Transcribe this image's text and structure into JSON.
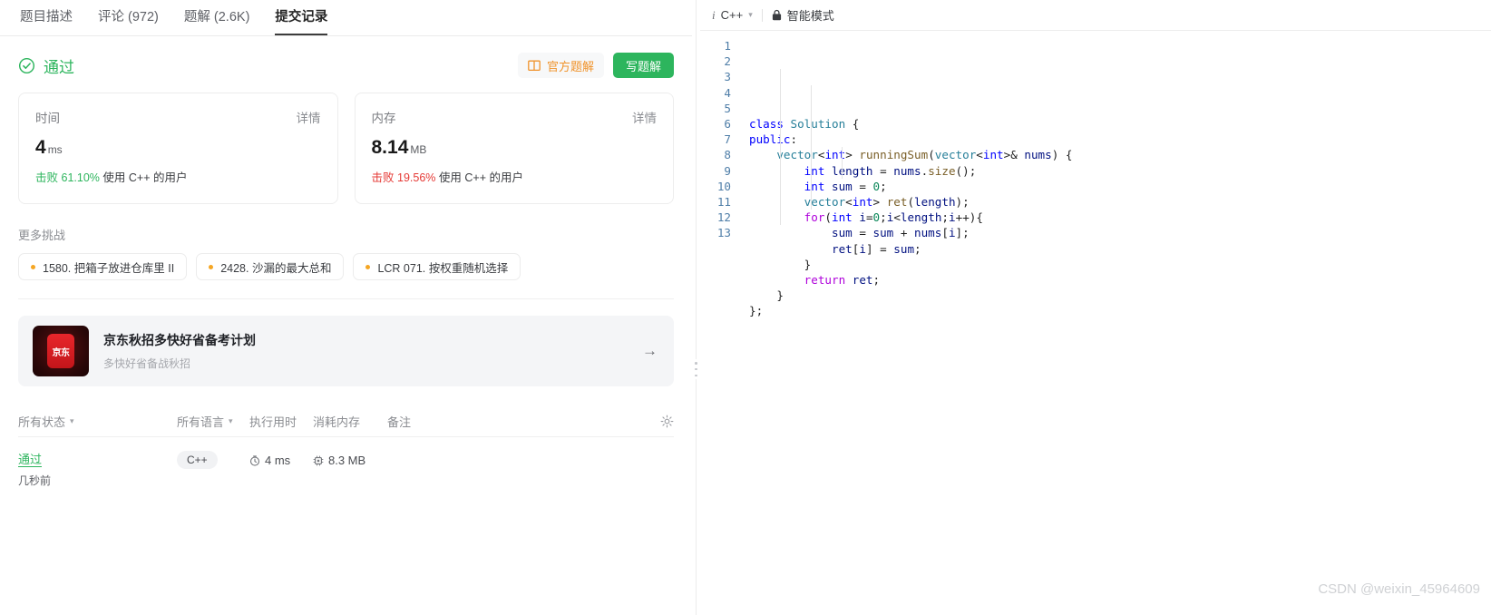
{
  "tabs": [
    {
      "label": "题目描述",
      "active": false
    },
    {
      "label": "评论 (972)",
      "active": false
    },
    {
      "label": "题解 (2.6K)",
      "active": false
    },
    {
      "label": "提交记录",
      "active": true
    }
  ],
  "status": {
    "text": "通过",
    "icon": "check-circle-icon",
    "color": "#2db55d"
  },
  "actions": {
    "official_solution": "官方题解",
    "official_icon": "book-icon",
    "write_solution": "写题解",
    "official_color": "#f0932b",
    "write_color": "#2db55d"
  },
  "stats": [
    {
      "label": "时间",
      "detail": "详情",
      "value": "4",
      "unit": "ms",
      "beat_prefix": "击败",
      "beat_percent": "61.10%",
      "beat_suffix": "使用 C++ 的用户",
      "beat_color": "#2db55d"
    },
    {
      "label": "内存",
      "detail": "详情",
      "value": "8.14",
      "unit": "MB",
      "beat_prefix": "击败",
      "beat_percent": "19.56%",
      "beat_suffix": "使用 C++ 的用户",
      "beat_color": "#e53935"
    }
  ],
  "more_challenges": {
    "title": "更多挑战",
    "items": [
      "1580. 把箱子放进仓库里 II",
      "2428. 沙漏的最大总和",
      "LCR 071. 按权重随机选择"
    ],
    "dot_color": "#f5a623"
  },
  "ad": {
    "logo_text": "京东",
    "title": "京东秋招多快好省备考计划",
    "subtitle": "多快好省备战秋招",
    "arrow": "→"
  },
  "table": {
    "headers": {
      "status": "所有状态",
      "language": "所有语言",
      "runtime": "执行用时",
      "memory": "消耗内存",
      "note": "备注",
      "settings_icon": "gear-icon"
    },
    "rows": [
      {
        "status": "通过",
        "time_ago": "几秒前",
        "language": "C++",
        "runtime": "4 ms",
        "memory": "8.3 MB",
        "runtime_icon": "stopwatch-icon",
        "memory_icon": "chip-icon",
        "note": ""
      }
    ]
  },
  "editor": {
    "info_glyph": "i",
    "language": "C++",
    "caret": "˅",
    "lock_icon": "lock-icon",
    "mode": "智能模式",
    "line_numbers": [
      "1",
      "2",
      "3",
      "4",
      "5",
      "6",
      "7",
      "8",
      "9",
      "10",
      "11",
      "12",
      "13"
    ],
    "code_lines": [
      [
        {
          "t": "kw",
          "s": "class"
        },
        {
          "t": "plain",
          "s": " "
        },
        {
          "t": "type",
          "s": "Solution"
        },
        {
          "t": "plain",
          "s": " {"
        }
      ],
      [
        {
          "t": "kw",
          "s": "public"
        },
        {
          "t": "plain",
          "s": ":"
        }
      ],
      [
        {
          "t": "plain",
          "s": "    "
        },
        {
          "t": "type",
          "s": "vector"
        },
        {
          "t": "plain",
          "s": "<"
        },
        {
          "t": "kw",
          "s": "int"
        },
        {
          "t": "plain",
          "s": "> "
        },
        {
          "t": "fn",
          "s": "runningSum"
        },
        {
          "t": "plain",
          "s": "("
        },
        {
          "t": "type",
          "s": "vector"
        },
        {
          "t": "plain",
          "s": "<"
        },
        {
          "t": "kw",
          "s": "int"
        },
        {
          "t": "plain",
          "s": ">& "
        },
        {
          "t": "var",
          "s": "nums"
        },
        {
          "t": "plain",
          "s": ") {"
        }
      ],
      [
        {
          "t": "plain",
          "s": "        "
        },
        {
          "t": "kw",
          "s": "int"
        },
        {
          "t": "plain",
          "s": " "
        },
        {
          "t": "var",
          "s": "length"
        },
        {
          "t": "plain",
          "s": " = "
        },
        {
          "t": "var",
          "s": "nums"
        },
        {
          "t": "plain",
          "s": "."
        },
        {
          "t": "fn",
          "s": "size"
        },
        {
          "t": "plain",
          "s": "();"
        }
      ],
      [
        {
          "t": "plain",
          "s": "        "
        },
        {
          "t": "kw",
          "s": "int"
        },
        {
          "t": "plain",
          "s": " "
        },
        {
          "t": "var",
          "s": "sum"
        },
        {
          "t": "plain",
          "s": " = "
        },
        {
          "t": "num",
          "s": "0"
        },
        {
          "t": "plain",
          "s": ";"
        }
      ],
      [
        {
          "t": "plain",
          "s": "        "
        },
        {
          "t": "type",
          "s": "vector"
        },
        {
          "t": "plain",
          "s": "<"
        },
        {
          "t": "kw",
          "s": "int"
        },
        {
          "t": "plain",
          "s": "> "
        },
        {
          "t": "fn",
          "s": "ret"
        },
        {
          "t": "plain",
          "s": "("
        },
        {
          "t": "var",
          "s": "length"
        },
        {
          "t": "plain",
          "s": ");"
        }
      ],
      [
        {
          "t": "plain",
          "s": "        "
        },
        {
          "t": "kw2",
          "s": "for"
        },
        {
          "t": "plain",
          "s": "("
        },
        {
          "t": "kw",
          "s": "int"
        },
        {
          "t": "plain",
          "s": " "
        },
        {
          "t": "var",
          "s": "i"
        },
        {
          "t": "plain",
          "s": "="
        },
        {
          "t": "num",
          "s": "0"
        },
        {
          "t": "plain",
          "s": ";"
        },
        {
          "t": "var",
          "s": "i"
        },
        {
          "t": "plain",
          "s": "<"
        },
        {
          "t": "var",
          "s": "length"
        },
        {
          "t": "plain",
          "s": ";"
        },
        {
          "t": "var",
          "s": "i"
        },
        {
          "t": "plain",
          "s": "++){"
        }
      ],
      [
        {
          "t": "plain",
          "s": "            "
        },
        {
          "t": "var",
          "s": "sum"
        },
        {
          "t": "plain",
          "s": " = "
        },
        {
          "t": "var",
          "s": "sum"
        },
        {
          "t": "plain",
          "s": " + "
        },
        {
          "t": "var",
          "s": "nums"
        },
        {
          "t": "plain",
          "s": "["
        },
        {
          "t": "var",
          "s": "i"
        },
        {
          "t": "plain",
          "s": "];"
        }
      ],
      [
        {
          "t": "plain",
          "s": "            "
        },
        {
          "t": "var",
          "s": "ret"
        },
        {
          "t": "plain",
          "s": "["
        },
        {
          "t": "var",
          "s": "i"
        },
        {
          "t": "plain",
          "s": "] = "
        },
        {
          "t": "var",
          "s": "sum"
        },
        {
          "t": "plain",
          "s": ";"
        }
      ],
      [
        {
          "t": "plain",
          "s": "        }"
        }
      ],
      [
        {
          "t": "plain",
          "s": "        "
        },
        {
          "t": "kw2",
          "s": "return"
        },
        {
          "t": "plain",
          "s": " "
        },
        {
          "t": "var",
          "s": "ret"
        },
        {
          "t": "plain",
          "s": ";"
        }
      ],
      [
        {
          "t": "plain",
          "s": "    }"
        }
      ],
      [
        {
          "t": "plain",
          "s": "};"
        }
      ]
    ]
  },
  "watermark": "CSDN @weixin_45964609"
}
